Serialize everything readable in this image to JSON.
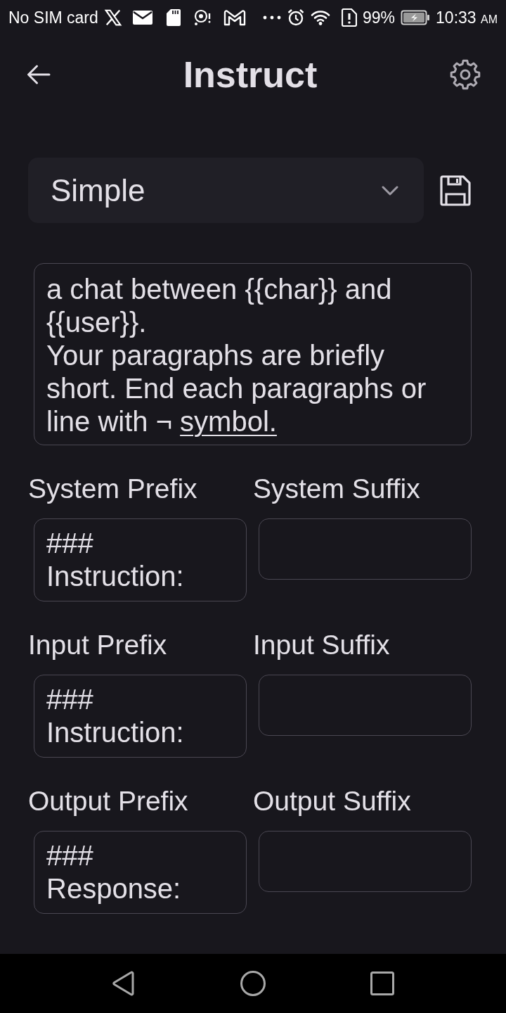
{
  "status_bar": {
    "carrier": "No SIM card",
    "battery_percent": "99%",
    "time": "10:33",
    "meridiem": "AM"
  },
  "header": {
    "title": "Instruct"
  },
  "preset": {
    "value": "Simple"
  },
  "prompt": {
    "text": "a chat between {{char}} and {{user}}.\nYour paragraphs are briefly short. End each paragraphs or line with ¬ ",
    "composing": "symbol."
  },
  "fields": [
    {
      "label": "System Prefix",
      "value": "###\nInstruction:"
    },
    {
      "label": "System Suffix"
    },
    {
      "label": "Input Prefix",
      "value": "###\nInstruction:"
    },
    {
      "label": "Input Suffix"
    },
    {
      "label": "Output Prefix",
      "value": "###\nResponse:"
    },
    {
      "label": "Output Suffix"
    }
  ]
}
